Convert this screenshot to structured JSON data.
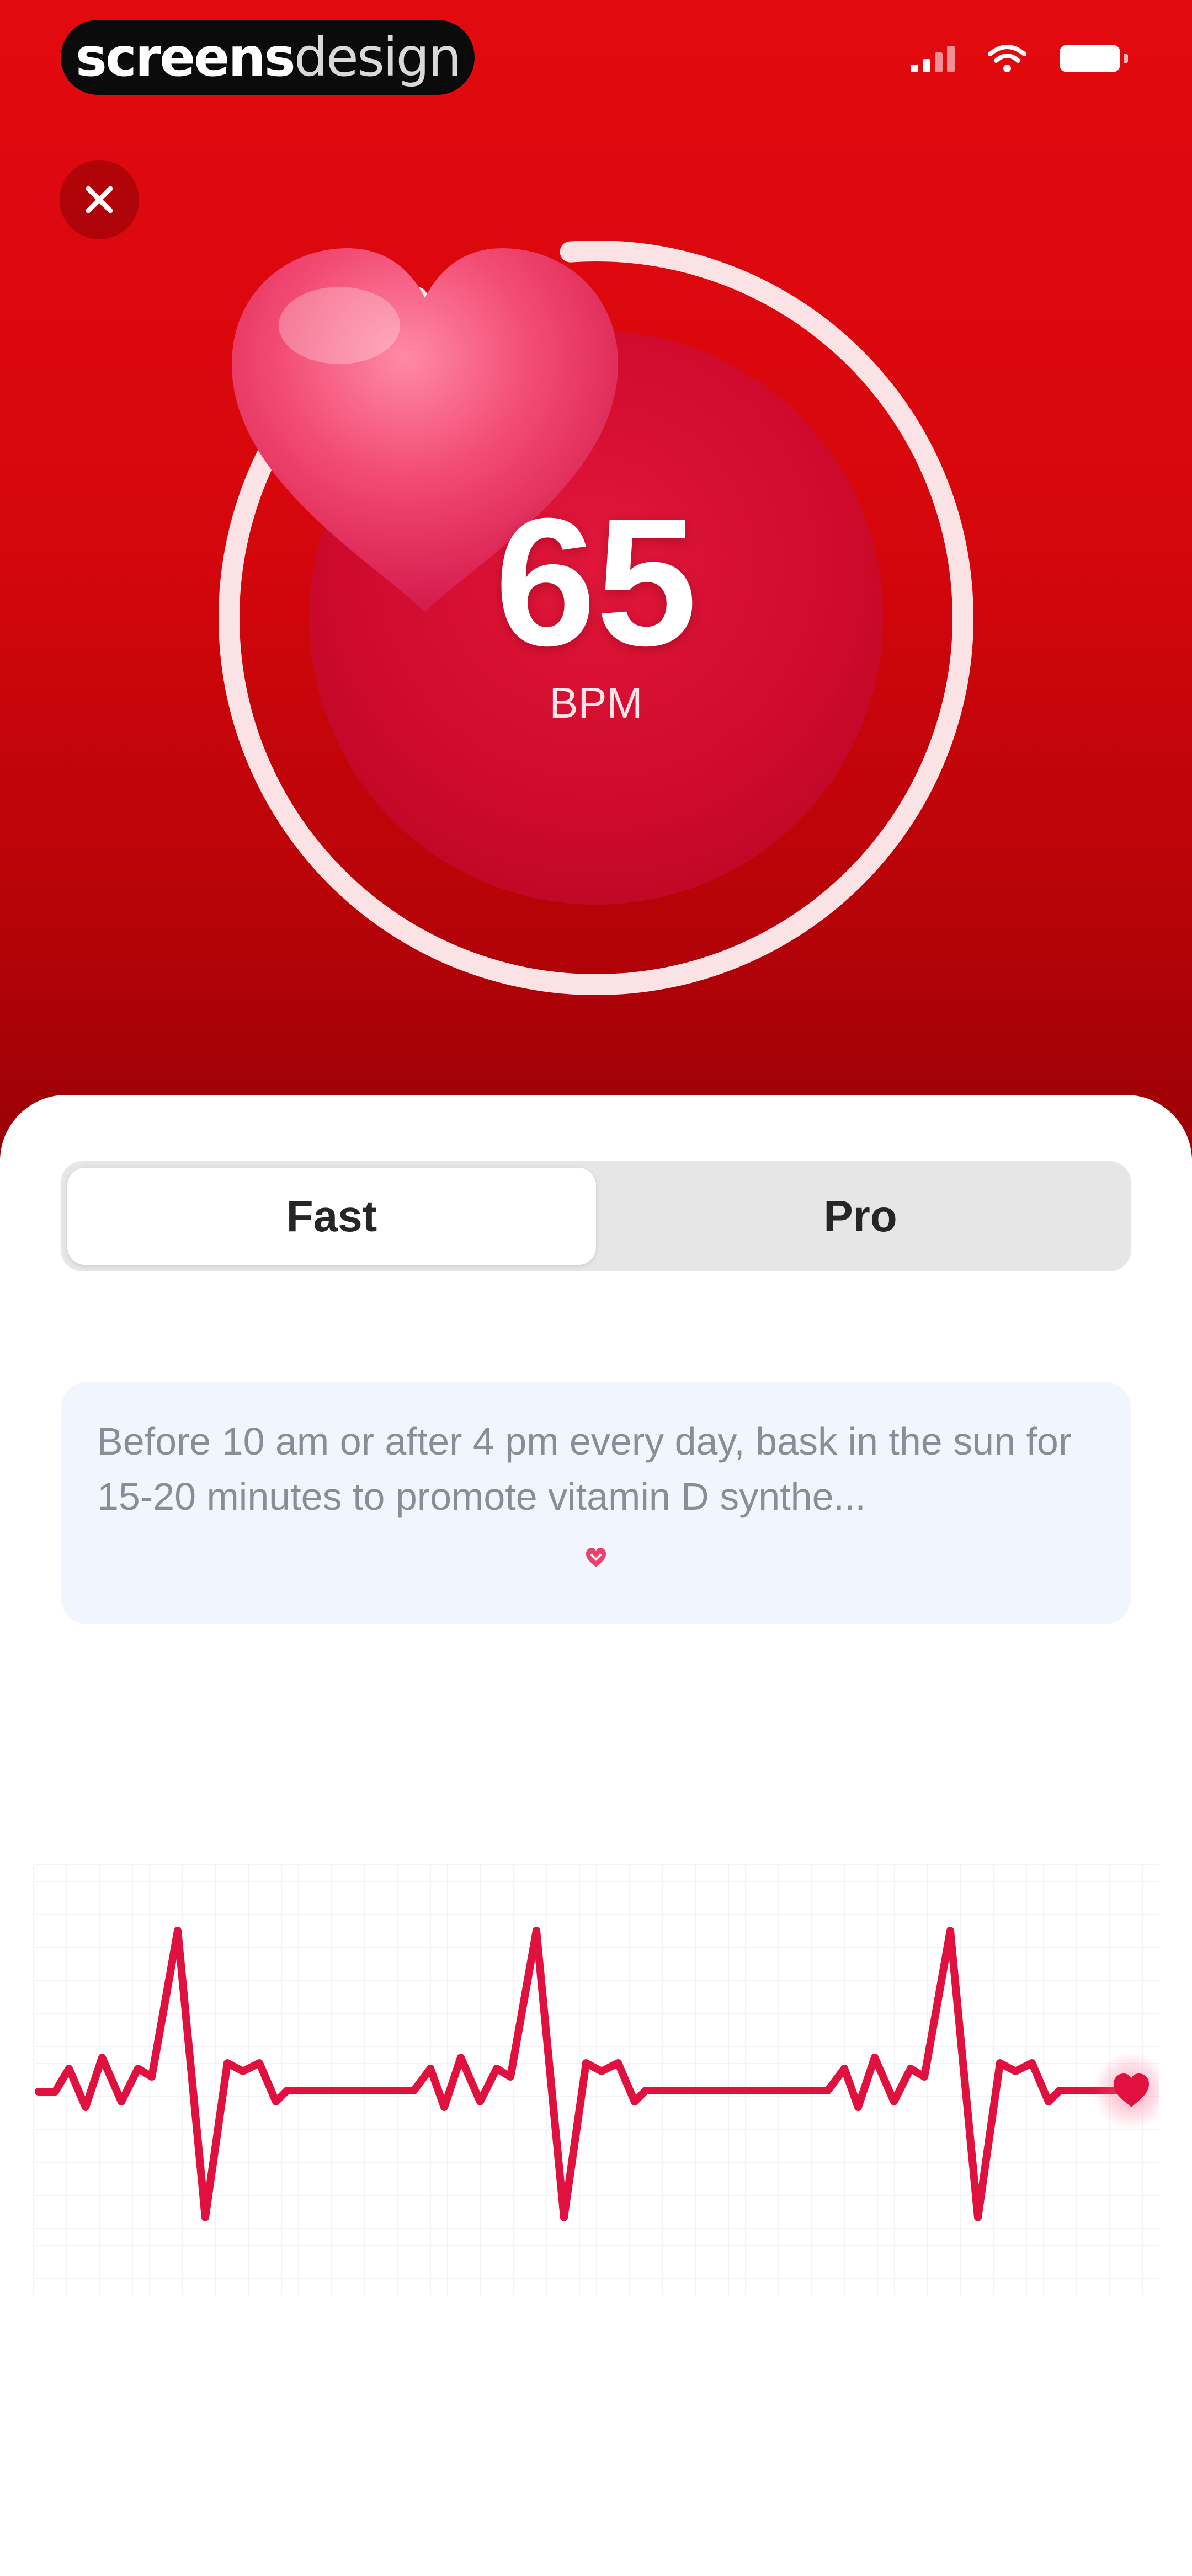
{
  "status_bar": {
    "brand_bold": "screens",
    "brand_light": "design",
    "icons": [
      "signal-icon",
      "wifi-icon",
      "battery-icon"
    ]
  },
  "header": {
    "close_icon": "close-icon"
  },
  "measurement": {
    "value": "65",
    "unit": "BPM",
    "progress": 0.93,
    "accent_color": "#d6070c"
  },
  "mode_toggle": {
    "options": [
      {
        "label": "Fast",
        "selected": true
      },
      {
        "label": "Pro",
        "selected": false
      }
    ]
  },
  "tip": {
    "text": "Before 10 am or after 4 pm every day, bask in the sun for 15-20 minutes to promote vitamin D synthe...",
    "expand_icon": "heart-chevron-icon"
  },
  "waveform": {
    "line_color": "#e0103f",
    "marker_icon": "heart-icon"
  }
}
